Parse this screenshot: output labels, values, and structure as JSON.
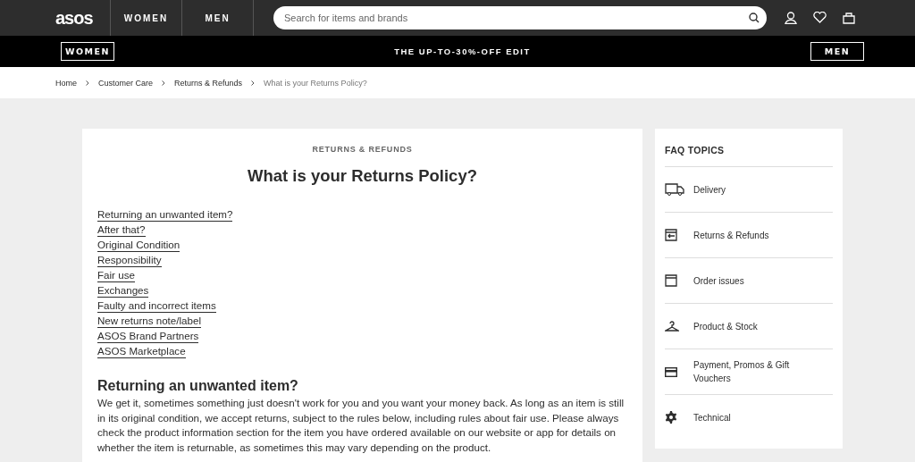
{
  "header": {
    "logo": "asos",
    "nav": [
      {
        "label": "WOMEN"
      },
      {
        "label": "MEN"
      }
    ],
    "search": {
      "placeholder": "Search for items and brands"
    }
  },
  "promo_bar": {
    "left": "WOMEN",
    "center": "THE UP-TO-30%-OFF EDIT",
    "right": "MEN"
  },
  "breadcrumb": [
    "Home",
    "Customer Care",
    "Returns & Refunds",
    "What is your Returns Policy?"
  ],
  "article": {
    "eyebrow": "RETURNS & REFUNDS",
    "title": "What is your Returns Policy?",
    "links": [
      "Returning an unwanted item?",
      "After that?",
      "Original Condition",
      "Responsibility",
      "Fair use",
      "Exchanges",
      "Faulty and incorrect items",
      "New returns note/label",
      "ASOS Brand Partners",
      "ASOS Marketplace"
    ],
    "section_heading": "Returning an unwanted item?",
    "paragraph": "We get it, sometimes something just doesn't work for you and you want your money back. As long as an item is still in its original condition, we accept returns, subject to the rules below, including rules about fair use. Please always check the product information section for the item you have ordered available on our website or app for details on whether the item is returnable, as sometimes this may vary depending on the product."
  },
  "sidebar": {
    "title": "FAQ TOPICS",
    "items": [
      {
        "label": "Delivery"
      },
      {
        "label": "Returns & Refunds"
      },
      {
        "label": "Order issues"
      },
      {
        "label": "Product & Stock"
      },
      {
        "label": "Payment, Promos & Gift Vouchers"
      },
      {
        "label": "Technical"
      }
    ]
  }
}
